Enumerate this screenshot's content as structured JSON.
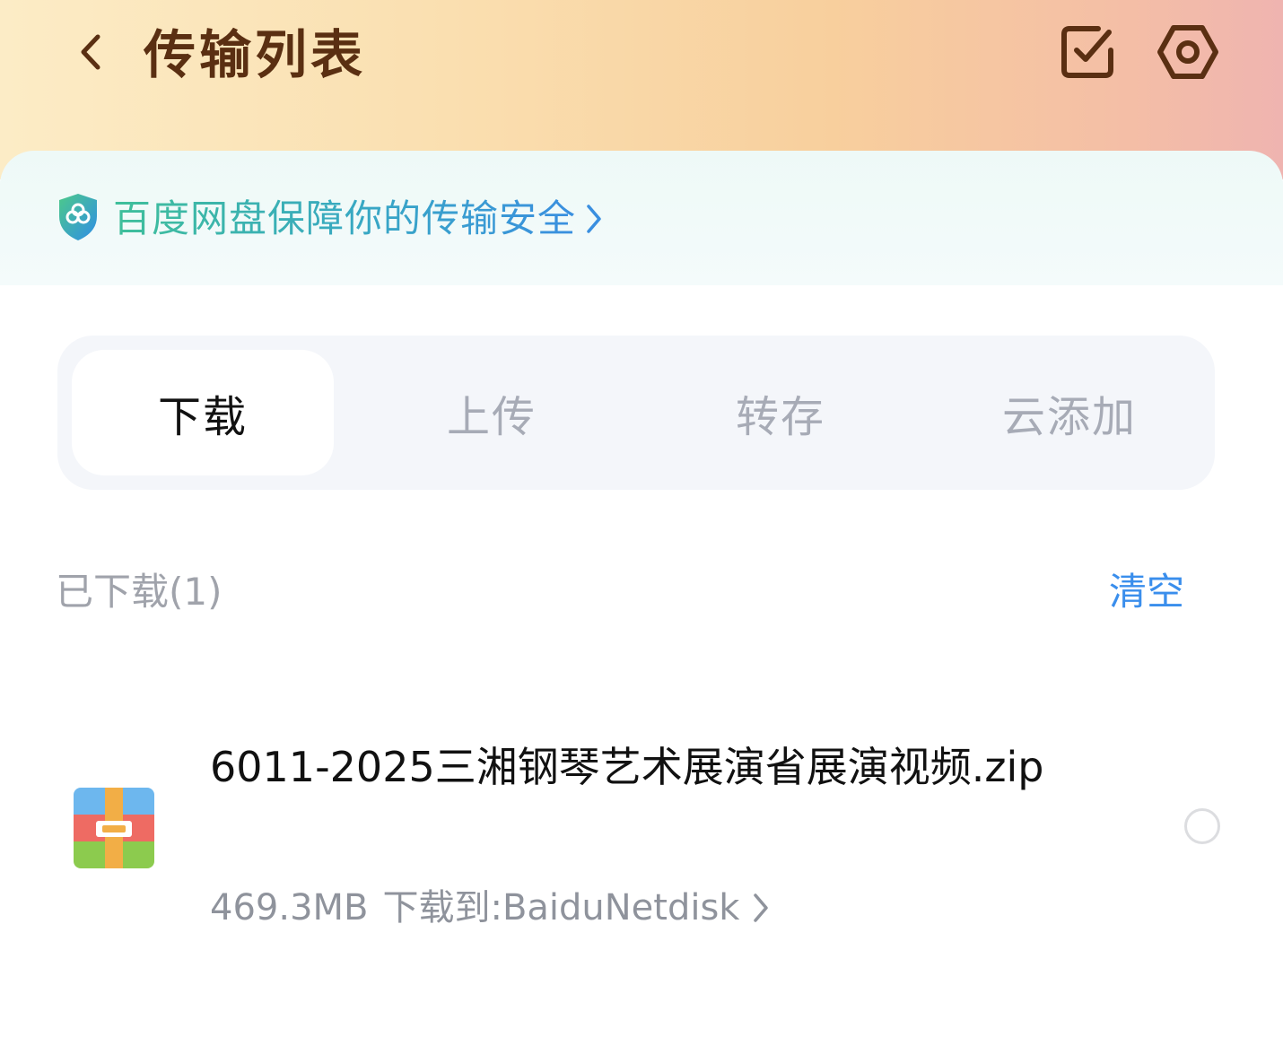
{
  "header": {
    "title": "传输列表",
    "icons": {
      "back": "chevron-left-icon",
      "select": "checkbox-icon",
      "settings": "gear-icon"
    }
  },
  "banner": {
    "text": "百度网盘保障你的传输安全",
    "icon": "shield-icon"
  },
  "tabs": [
    {
      "label": "下载",
      "active": true
    },
    {
      "label": "上传",
      "active": false
    },
    {
      "label": "转存",
      "active": false
    },
    {
      "label": "云添加",
      "active": false
    }
  ],
  "section": {
    "label": "已下载(1)",
    "clear_label": "清空"
  },
  "files": [
    {
      "name": "6011-2025三湘钢琴艺术展演省展演视频.zip",
      "size": "469.3MB",
      "destination": "下载到:BaiduNetdisk",
      "icon": "zip-archive-icon",
      "selected": false
    }
  ],
  "colors": {
    "title": "#5a2f12",
    "accent": "#3a8eec",
    "muted": "#a0a3ab"
  }
}
